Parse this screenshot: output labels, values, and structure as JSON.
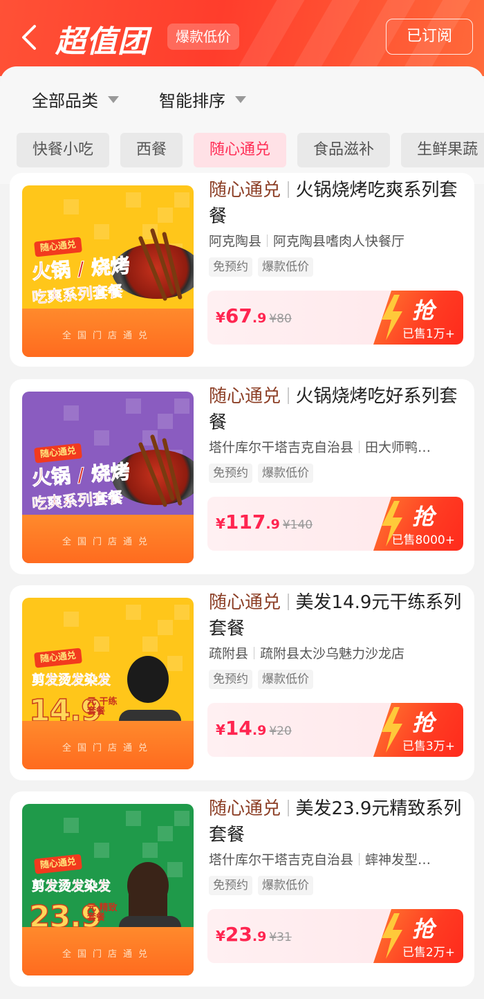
{
  "header": {
    "logo_text": "超值团",
    "logo_badge": "爆款低价",
    "subscribe_label": "已订阅"
  },
  "filters": {
    "category_label": "全部品类",
    "sort_label": "智能排序"
  },
  "chips": [
    {
      "label": "快餐小吃",
      "active": false
    },
    {
      "label": "西餐",
      "active": false
    },
    {
      "label": "随心通兑",
      "active": true
    },
    {
      "label": "食品滋补",
      "active": false
    },
    {
      "label": "生鲜果蔬",
      "active": false
    }
  ],
  "products": [
    {
      "brand": "随心通兑",
      "title": "火锅烧烤吃爽系列套餐",
      "county": "阿克陶县",
      "shop": "阿克陶县嗜肉人快餐厅",
      "tags": [
        "免预约",
        "爆款低价"
      ],
      "price_int": "67",
      "price_dec": ".9",
      "orig_price": "¥80",
      "grab_label": "抢",
      "sold": "已售1万+",
      "thumb": {
        "theme": "yellow",
        "badge": "随心通兑",
        "line1": "火锅 / 烧烤",
        "line2": "吃爽系列套餐",
        "footer": "全国门店通兑",
        "color": "#ffc61a"
      }
    },
    {
      "brand": "随心通兑",
      "title": "火锅烧烤吃好系列套餐",
      "county": "塔什库尔干塔吉克自治县",
      "shop": "田大师鸭…",
      "tags": [
        "免预约",
        "爆款低价"
      ],
      "price_int": "117",
      "price_dec": ".9",
      "orig_price": "¥140",
      "grab_label": "抢",
      "sold": "已售8000+",
      "thumb": {
        "theme": "purple",
        "badge": "随心通兑",
        "line1": "火锅 / 烧烤",
        "line2": "吃爽系列套餐",
        "footer": "全国门店通兑",
        "color": "#8a5cc0"
      }
    },
    {
      "brand": "随心通兑",
      "title": "美发14.9元干练系列套餐",
      "county": "疏附县",
      "shop": "疏附县太沙乌魅力沙龙店",
      "tags": [
        "免预约",
        "爆款低价"
      ],
      "price_int": "14",
      "price_dec": ".9",
      "orig_price": "¥20",
      "grab_label": "抢",
      "sold": "已售3万+",
      "thumb": {
        "theme": "yellow",
        "badge": "随心通兑",
        "line1": "剪发烫发染发",
        "big": "14.9",
        "sub": "元 干练\n套餐",
        "footer": "全国门店通兑",
        "color": "#ffc61a"
      }
    },
    {
      "brand": "随心通兑",
      "title": "美发23.9元精致系列套餐",
      "county": "塔什库尔干塔吉克自治县",
      "shop": "蟀神发型…",
      "tags": [
        "免预约",
        "爆款低价"
      ],
      "price_int": "23",
      "price_dec": ".9",
      "orig_price": "¥31",
      "grab_label": "抢",
      "sold": "已售2万+",
      "thumb": {
        "theme": "green",
        "badge": "随心通兑",
        "line1": "剪发烫发染发",
        "big": "23.9",
        "sub": "元 精致\n套餐",
        "footer": "全国门店通兑",
        "color": "#1f9a4a"
      }
    }
  ]
}
